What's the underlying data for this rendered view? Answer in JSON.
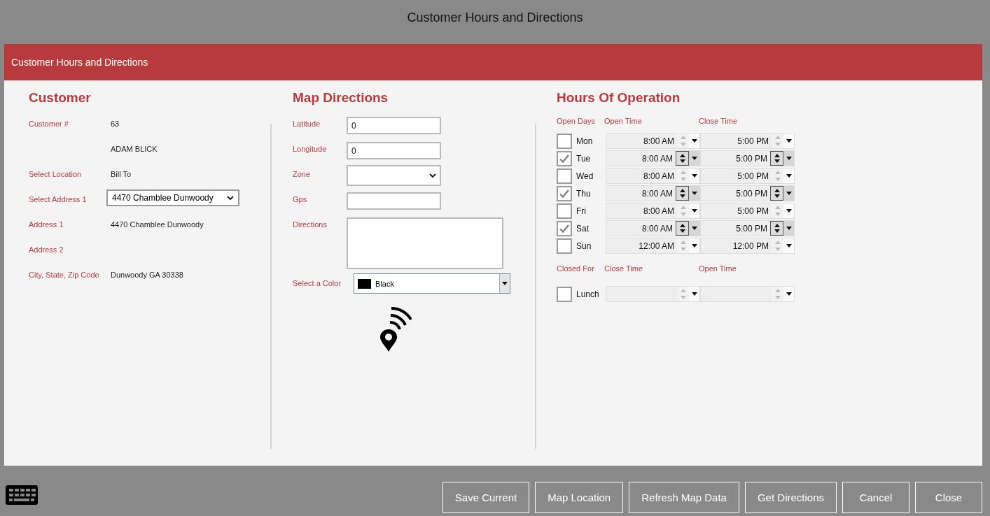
{
  "window": {
    "title": "Customer Hours and Directions"
  },
  "dialog": {
    "header": "Customer Hours and Directions"
  },
  "customer": {
    "heading": "Customer",
    "fields": [
      {
        "kind": "text",
        "label": "Customer #",
        "value": "63"
      },
      {
        "kind": "text",
        "value": "ADAM BLICK"
      },
      {
        "kind": "text",
        "label": "Select Location",
        "value": "Bill To"
      },
      {
        "kind": "select",
        "label": "Select Address 1",
        "value": "4470 Chamblee Dunwoody"
      },
      {
        "kind": "text",
        "label": "Address 1",
        "value": "4470 Chamblee Dunwoody"
      },
      {
        "kind": "text",
        "label": "Address 2"
      },
      {
        "kind": "text",
        "label": "City, State, Zip Code",
        "value": "Dunwoody GA 30338"
      }
    ]
  },
  "map": {
    "heading": "Map Directions",
    "fields": [
      {
        "kind": "input",
        "label": "Latitude",
        "value": "0"
      },
      {
        "kind": "input",
        "label": "Longitude",
        "value": "0"
      },
      {
        "kind": "select",
        "label": "Zone"
      },
      {
        "kind": "input",
        "label": "Gps"
      },
      {
        "kind": "textarea",
        "label": "Directions"
      }
    ],
    "color_field": {
      "label": "Select a Color",
      "value": "Black",
      "color": "#000000"
    }
  },
  "hours": {
    "heading": "Hours Of Operation",
    "columns": [
      "Open Days",
      "Open Time",
      "Close Time"
    ],
    "days": [
      {
        "day": "Mon",
        "checked": false,
        "open": "8:00 AM",
        "close": "5:00 PM"
      },
      {
        "day": "Tue",
        "checked": true,
        "open": "8:00 AM",
        "close": "5:00 PM"
      },
      {
        "day": "Wed",
        "checked": false,
        "open": "8:00 AM",
        "close": "5:00 PM"
      },
      {
        "day": "Thu",
        "checked": true,
        "open": "8:00 AM",
        "close": "5:00 PM"
      },
      {
        "day": "Fri",
        "checked": false,
        "open": "8:00 AM",
        "close": "5:00 PM"
      },
      {
        "day": "Sat",
        "checked": true,
        "open": "8:00 AM",
        "close": "5:00 PM"
      },
      {
        "day": "Sun",
        "checked": false,
        "open": "12:00 AM",
        "close": "12:00 PM"
      }
    ],
    "closed_columns": [
      "Closed For",
      "Close Time",
      "Open Time"
    ],
    "closed": [
      {
        "day": "Lunch",
        "checked": false
      }
    ]
  },
  "buttons": [
    "Save Current",
    "Map Location",
    "Refresh Map Data",
    "Get Directions",
    "Cancel",
    "Close"
  ]
}
